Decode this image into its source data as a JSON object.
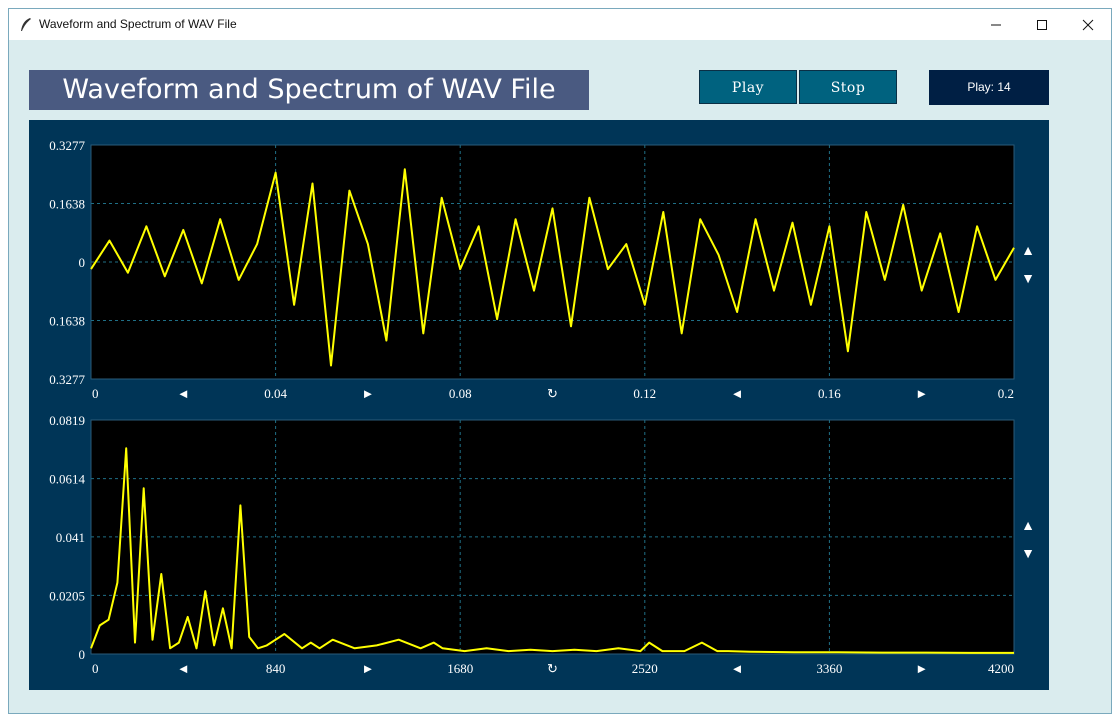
{
  "window": {
    "title": "Waveform and Spectrum of WAV File"
  },
  "header": {
    "title": "Waveform and Spectrum of WAV File",
    "play_label": "Play",
    "stop_label": "Stop",
    "counter": "Play: 14"
  },
  "colors": {
    "panel_bg": "#003557",
    "plot_bg": "#000000",
    "trace": "#ffff00",
    "grid": "#1f6f86",
    "title_bg": "#4a5a81",
    "button_bg": "#00627f",
    "counter_bg": "#001f44"
  },
  "controls": {
    "left_arrow": "◄",
    "right_arrow": "►",
    "reset": "↻",
    "up_arrow": "▲",
    "down_arrow": "▼"
  },
  "chart_data": [
    {
      "type": "line",
      "name": "waveform",
      "ylim": [
        -0.3277,
        0.3277
      ],
      "y_ticks": [
        0.3277,
        0.1638,
        0,
        -0.1638,
        -0.3277
      ],
      "y_tick_labels": [
        "0.3277",
        "0.1638",
        "0",
        "0.1638",
        "0.3277"
      ],
      "xlim": [
        0,
        0.2
      ],
      "x_ticks": [
        0,
        0.04,
        0.08,
        0.12,
        0.16,
        0.2
      ],
      "x_tick_labels": [
        "0",
        "0.04",
        "0.08",
        "0.12",
        "0.16",
        "0.2"
      ],
      "grid": true,
      "x": [
        0,
        0.004,
        0.008,
        0.012,
        0.016,
        0.02,
        0.024,
        0.028,
        0.032,
        0.036,
        0.04,
        0.044,
        0.048,
        0.052,
        0.056,
        0.06,
        0.064,
        0.068,
        0.072,
        0.076,
        0.08,
        0.084,
        0.088,
        0.092,
        0.096,
        0.1,
        0.104,
        0.108,
        0.112,
        0.116,
        0.12,
        0.124,
        0.128,
        0.132,
        0.136,
        0.14,
        0.144,
        0.148,
        0.152,
        0.156,
        0.16,
        0.164,
        0.168,
        0.172,
        0.176,
        0.18,
        0.184,
        0.188,
        0.192,
        0.196,
        0.2
      ],
      "y": [
        -0.02,
        0.06,
        -0.03,
        0.1,
        -0.04,
        0.09,
        -0.06,
        0.12,
        -0.05,
        0.05,
        0.25,
        -0.12,
        0.22,
        -0.29,
        0.2,
        0.05,
        -0.22,
        0.26,
        -0.2,
        0.18,
        -0.02,
        0.1,
        -0.16,
        0.12,
        -0.08,
        0.15,
        -0.18,
        0.18,
        -0.02,
        0.05,
        -0.12,
        0.14,
        -0.2,
        0.12,
        0.02,
        -0.14,
        0.12,
        -0.08,
        0.11,
        -0.12,
        0.1,
        -0.25,
        0.14,
        -0.05,
        0.16,
        -0.08,
        0.08,
        -0.14,
        0.1,
        -0.05,
        0.04
      ]
    },
    {
      "type": "line",
      "name": "spectrum",
      "ylim": [
        0,
        0.0819
      ],
      "y_ticks": [
        0.0819,
        0.0614,
        0.041,
        0.0205,
        0
      ],
      "y_tick_labels": [
        "0.0819",
        "0.0614",
        "0.041",
        "0.0205",
        "0"
      ],
      "xlim": [
        0,
        4200
      ],
      "x_ticks": [
        0,
        840,
        1680,
        2520,
        3360,
        4200
      ],
      "x_tick_labels": [
        "0",
        "840",
        "1680",
        "2520",
        "3360",
        "4200"
      ],
      "grid": true,
      "x": [
        0,
        40,
        80,
        120,
        160,
        200,
        240,
        280,
        320,
        360,
        400,
        440,
        480,
        520,
        560,
        600,
        640,
        680,
        720,
        760,
        800,
        880,
        960,
        1000,
        1040,
        1100,
        1200,
        1300,
        1400,
        1500,
        1560,
        1600,
        1700,
        1800,
        1900,
        2000,
        2100,
        2200,
        2300,
        2400,
        2500,
        2540,
        2600,
        2700,
        2780,
        2850,
        2900,
        3000,
        3200,
        3400,
        3600,
        3800,
        4000,
        4200
      ],
      "y": [
        0.002,
        0.01,
        0.012,
        0.025,
        0.072,
        0.004,
        0.058,
        0.005,
        0.028,
        0.002,
        0.004,
        0.013,
        0.002,
        0.022,
        0.003,
        0.016,
        0.002,
        0.052,
        0.006,
        0.002,
        0.003,
        0.007,
        0.002,
        0.004,
        0.002,
        0.005,
        0.002,
        0.003,
        0.005,
        0.002,
        0.004,
        0.002,
        0.001,
        0.002,
        0.001,
        0.0015,
        0.001,
        0.0015,
        0.001,
        0.002,
        0.001,
        0.004,
        0.001,
        0.001,
        0.004,
        0.001,
        0.001,
        0.0008,
        0.0006,
        0.0006,
        0.0005,
        0.0005,
        0.0004,
        0.0004
      ]
    }
  ]
}
